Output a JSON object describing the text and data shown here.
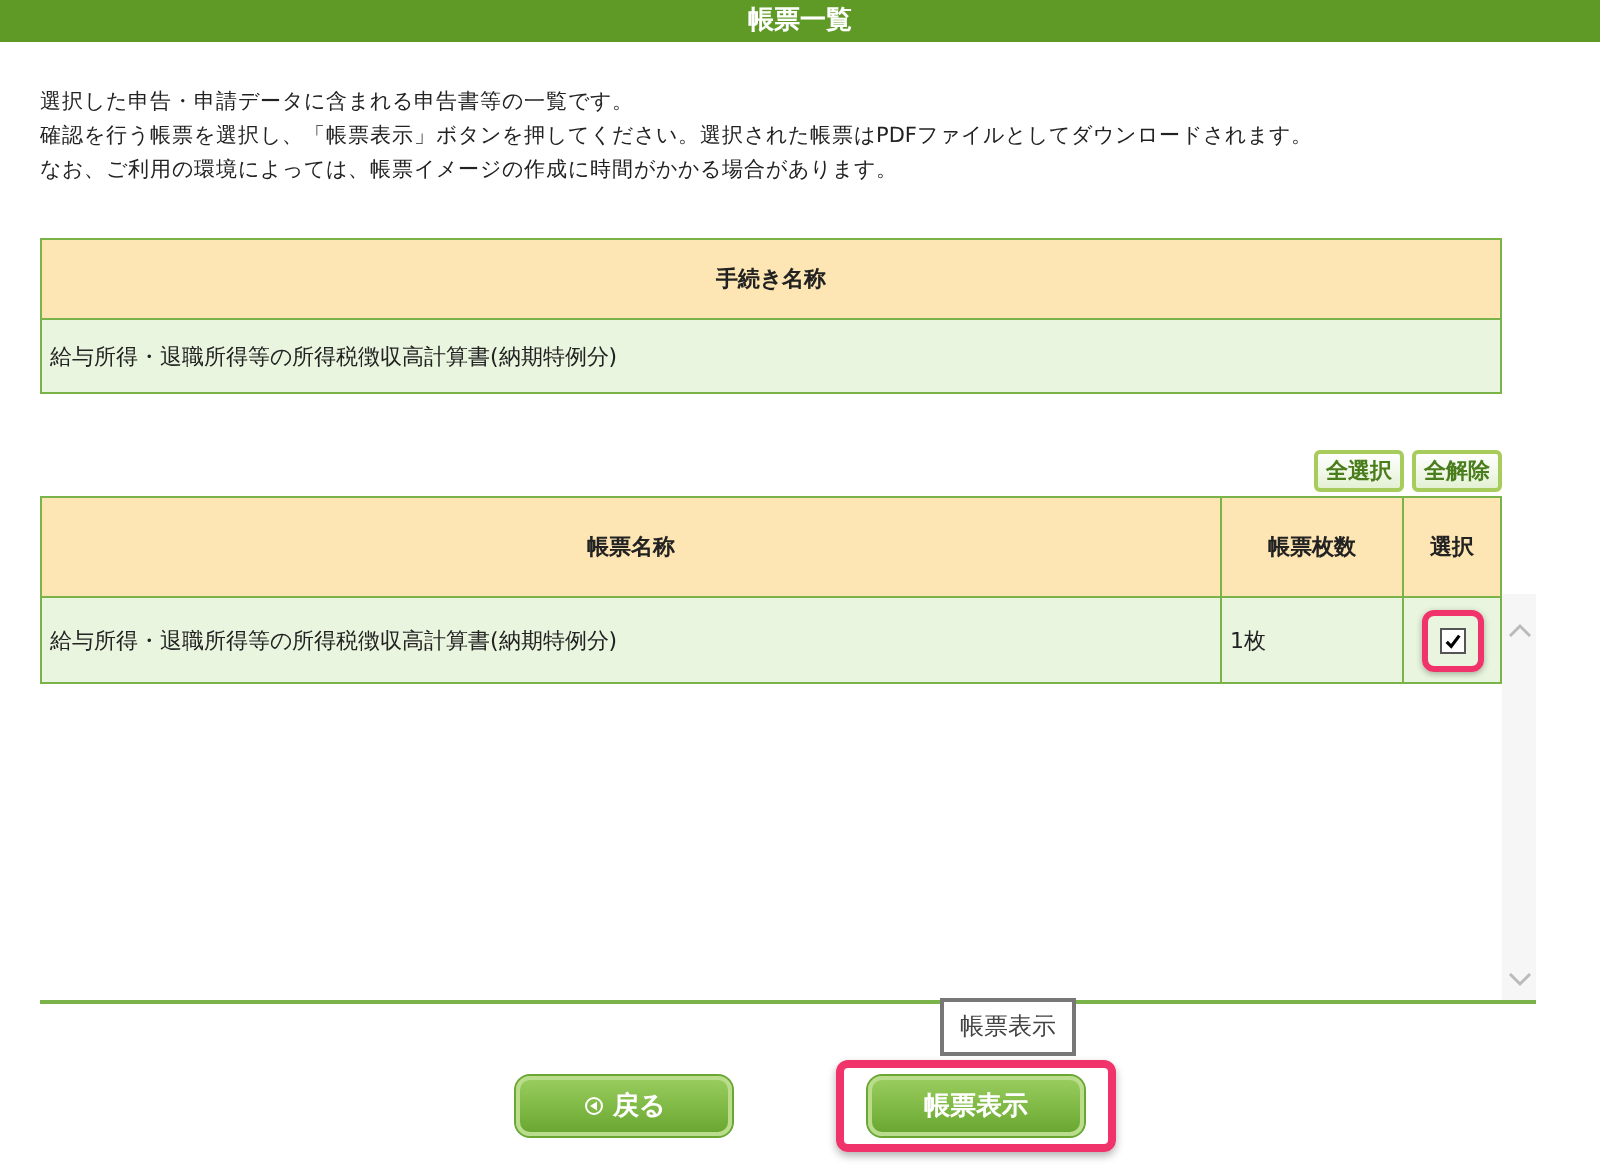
{
  "header": {
    "title": "帳票一覧"
  },
  "intro": [
    "選択した申告・申請データに含まれる申告書等の一覧です。",
    "確認を行う帳票を選択し、「帳票表示」ボタンを押してください。選択された帳票はPDFファイルとしてダウンロードされます。",
    "なお、ご利用の環境によっては、帳票イメージの作成に時間がかかる場合があります。"
  ],
  "procedure_table": {
    "heading": "手続き名称",
    "value": "給与所得・退職所得等の所得税徴収高計算書(納期特例分)"
  },
  "select_buttons": [
    "全選択",
    "全解除"
  ],
  "forms_table": {
    "columns": [
      "帳票名称",
      "帳票枚数",
      "選択"
    ],
    "rows": [
      {
        "name": "給与所得・退職所得等の所得税徴収高計算書(納期特例分)",
        "count": "1枚",
        "checked": true,
        "highlighted": true
      }
    ]
  },
  "tooltip": "帳票表示",
  "buttons": [
    {
      "label": "戻る",
      "kind": "back",
      "highlighted": false
    },
    {
      "label": "帳票表示",
      "kind": "primary",
      "highlighted": true
    }
  ]
}
